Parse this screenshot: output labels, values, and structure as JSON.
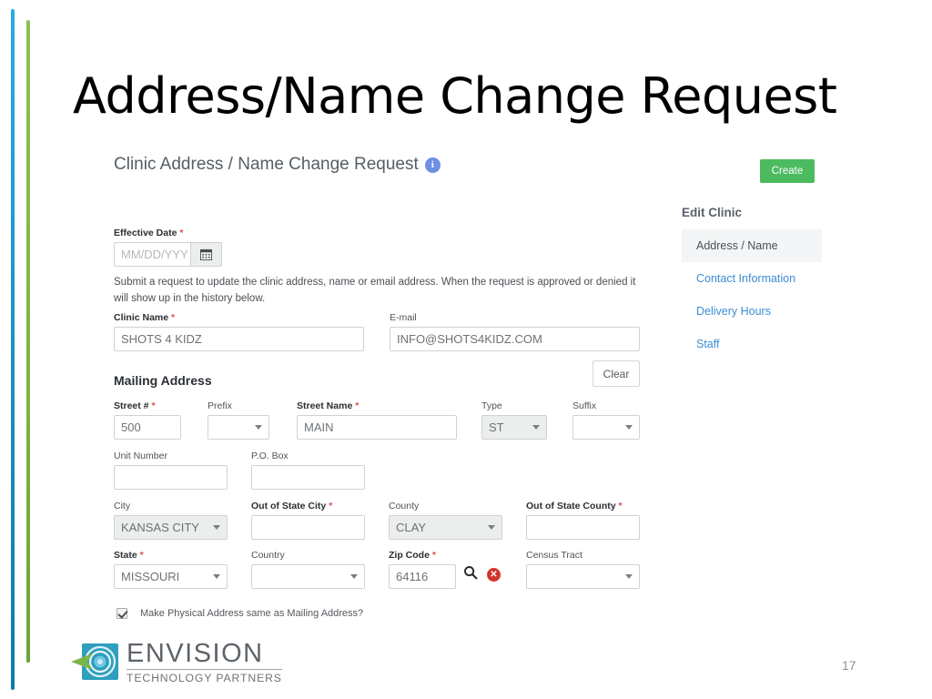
{
  "slide": {
    "title": "Address/Name Change Request",
    "page_number": "17",
    "accents": {
      "blue_rail": "#1b8ec2",
      "green_rail": "#7cb342"
    }
  },
  "app": {
    "heading": "Clinic Address / Name Change Request",
    "info_icon": "info-icon",
    "create_button": "Create",
    "create_button_color": "#4cbb5f",
    "help_text": "Submit a request to update the clinic address, name or email address. When the request is approved or denied it will show up in the history below.",
    "section_title": "Mailing Address",
    "clear_button": "Clear",
    "effective_date": {
      "label": "Effective Date",
      "required": true,
      "value": "",
      "placeholder": "MM/DD/YYY",
      "calendar_icon": "calendar-icon"
    },
    "clinic_name": {
      "label": "Clinic Name",
      "required": true,
      "value": "SHOTS 4 KIDZ"
    },
    "email": {
      "label": "E-mail",
      "required": false,
      "value": "INFO@SHOTS4KIDZ.COM"
    },
    "street_number": {
      "label": "Street #",
      "required": true,
      "value": "500"
    },
    "prefix": {
      "label": "Prefix",
      "required": false,
      "value": ""
    },
    "street_name": {
      "label": "Street Name",
      "required": true,
      "value": "MAIN"
    },
    "type": {
      "label": "Type",
      "required": false,
      "value": "ST"
    },
    "suffix": {
      "label": "Suffix",
      "required": false,
      "value": ""
    },
    "unit_number": {
      "label": "Unit Number",
      "required": false,
      "value": ""
    },
    "po_box": {
      "label": "P.O. Box",
      "required": false,
      "value": ""
    },
    "city": {
      "label": "City",
      "required": false,
      "value": "KANSAS CITY"
    },
    "out_of_state_city": {
      "label": "Out of State City",
      "required": true,
      "value": ""
    },
    "county": {
      "label": "County",
      "required": false,
      "value": "CLAY"
    },
    "out_of_state_county": {
      "label": "Out of State County",
      "required": true,
      "value": ""
    },
    "state": {
      "label": "State",
      "required": true,
      "value": "MISSOURI"
    },
    "country": {
      "label": "Country",
      "required": false,
      "value": ""
    },
    "zip_code": {
      "label": "Zip Code",
      "required": true,
      "value": "64116"
    },
    "census_tract": {
      "label": "Census Tract",
      "required": false,
      "value": ""
    },
    "zip_search_icon": "search-icon",
    "zip_clear_icon": "clear-circle-icon",
    "same_address_checkbox": {
      "label": "Make Physical Address same as Mailing Address?",
      "checked": true
    }
  },
  "sidebar": {
    "title": "Edit Clinic",
    "items": [
      {
        "label": "Address / Name",
        "active": true
      },
      {
        "label": "Contact Information",
        "active": false
      },
      {
        "label": "Delivery Hours",
        "active": false
      },
      {
        "label": "Staff",
        "active": false
      }
    ]
  },
  "footer": {
    "logo_name": "ENVISION",
    "logo_tagline": "TECHNOLOGY PARTNERS"
  }
}
